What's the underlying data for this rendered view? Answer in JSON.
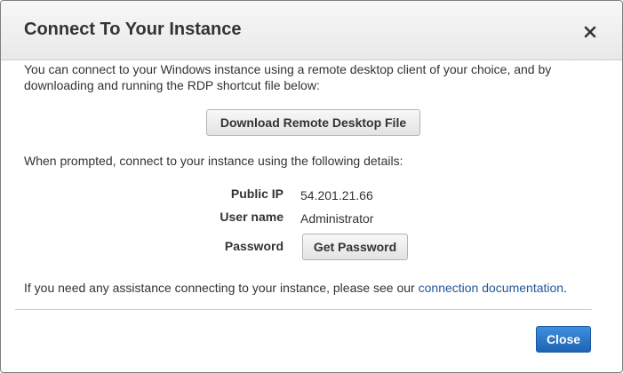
{
  "dialog": {
    "title": "Connect To Your Instance",
    "close_icon": "close-x-icon",
    "intro": "You can connect to your Windows instance using a remote desktop client of your choice, and by downloading and running the RDP shortcut file below:",
    "download_button_label": "Download Remote Desktop File",
    "prompt": "When prompted, connect to your instance using the following details:",
    "details": {
      "public_ip_label": "Public IP",
      "public_ip_value": "54.201.21.66",
      "user_name_label": "User name",
      "user_name_value": "Administrator",
      "password_label": "Password",
      "get_password_label": "Get Password"
    },
    "assistance_text": "If you need any assistance connecting to your instance, please see our",
    "assistance_link": "connection documentation",
    "assistance_period": ".",
    "close_button_label": "Close"
  },
  "colors": {
    "link": "#1e5799",
    "primary_button": "#2a77c9"
  }
}
